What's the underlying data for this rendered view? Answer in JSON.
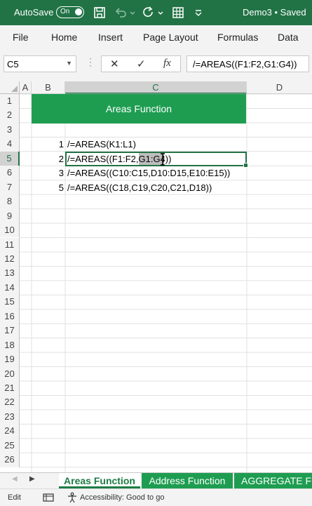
{
  "titlebar": {
    "autosave_label": "AutoSave",
    "toggle_state": "On",
    "doc_title": "Demo3 • Saved",
    "icons": [
      "save-icon",
      "undo-icon",
      "redo-icon",
      "customize-icon"
    ]
  },
  "ribbon": {
    "tabs": [
      "File",
      "Home",
      "Insert",
      "Page Layout",
      "Formulas",
      "Data"
    ]
  },
  "formula_bar": {
    "name_box": "C5",
    "cancel_glyph": "✕",
    "enter_glyph": "✓",
    "fx_glyph": "fx",
    "formula": "/=AREAS((F1:F2,G1:G4))"
  },
  "columns": [
    "A",
    "B",
    "C",
    "D"
  ],
  "rows": [
    "1",
    "2",
    "3",
    "4",
    "5",
    "6",
    "7",
    "8",
    "9",
    "10",
    "11",
    "12",
    "13",
    "14",
    "15",
    "16",
    "17",
    "18",
    "19",
    "20",
    "21",
    "22",
    "23",
    "24",
    "25",
    "26"
  ],
  "selected_cell": {
    "column": "C",
    "row": "5"
  },
  "sheet": {
    "title": "Areas Function",
    "entries": [
      {
        "num": "1",
        "formula": "/=AREAS(K1:L1)"
      },
      {
        "num": "2",
        "formula": "/=AREAS((F1:F2,G1:G4))"
      },
      {
        "num": "3",
        "formula": "/=AREAS((C10:C15,D10:D15,E10:E15))"
      },
      {
        "num": "5",
        "formula": "/=AREAS((C18,C19,C20,C21,D18))"
      }
    ]
  },
  "sheet_tabs": [
    "Areas Function",
    "Address Function",
    "AGGREGATE Fun"
  ],
  "statusbar": {
    "mode": "Edit",
    "accessibility": "Accessibility: Good to go"
  },
  "colors": {
    "accent": "#217346",
    "header_fill": "#1e9d51"
  }
}
